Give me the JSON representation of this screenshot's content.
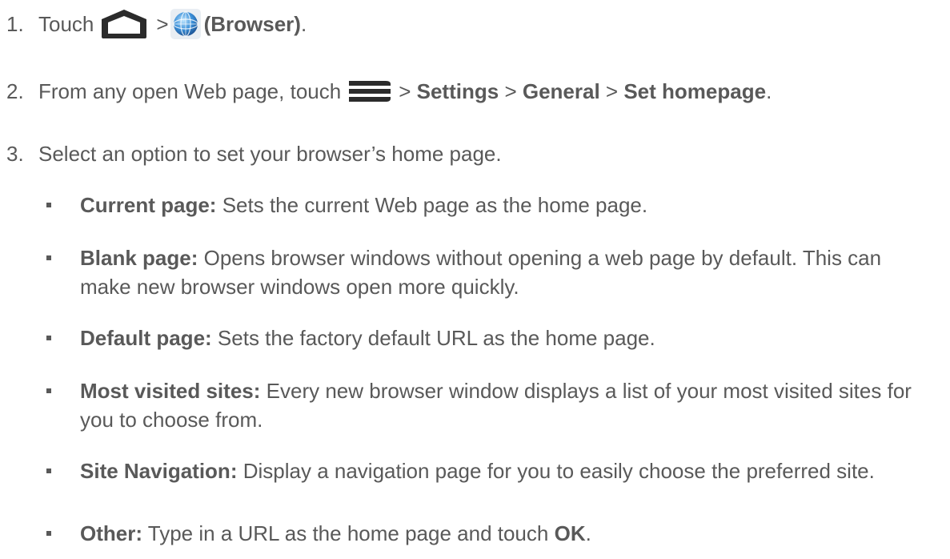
{
  "steps": [
    {
      "number": "1.",
      "text_before": "Touch",
      "sep1": ">",
      "browser_label": "(Browser)",
      "end": "."
    },
    {
      "number": "2.",
      "text_before": "From any open Web page, touch",
      "sep1": ">",
      "settings": "Settings",
      "sep2": ">",
      "general": "General",
      "sep3": ">",
      "set_homepage": "Set homepage",
      "end": "."
    },
    {
      "number": "3.",
      "text": "Select an option to set your browser’s home page."
    }
  ],
  "options": [
    {
      "term": "Current page:",
      "desc": "Sets the current Web page as the home page."
    },
    {
      "term": "Blank page:",
      "desc": "Opens browser windows without opening a web page by default. This can make new browser windows open more quickly."
    },
    {
      "term": "Default page:",
      "desc": "Sets the factory default URL as the home page."
    },
    {
      "term": "Most visited sites:",
      "desc": "Every new browser window displays a list of your most visited sites for you to choose from."
    },
    {
      "term": "Site Navigation:",
      "desc": "Display a navigation page for you to easily choose the preferred site."
    },
    {
      "term": "Other:",
      "desc": "Type in a URL as the home page and touch",
      "ok": "OK",
      "end": "."
    }
  ],
  "icons": {
    "home": "home-icon",
    "browser": "browser-globe-icon",
    "menu": "menu-icon"
  },
  "colors": {
    "text": "#595959",
    "icon_dark": "#2b2b2b",
    "globe_blue": "#3a8fd8"
  }
}
